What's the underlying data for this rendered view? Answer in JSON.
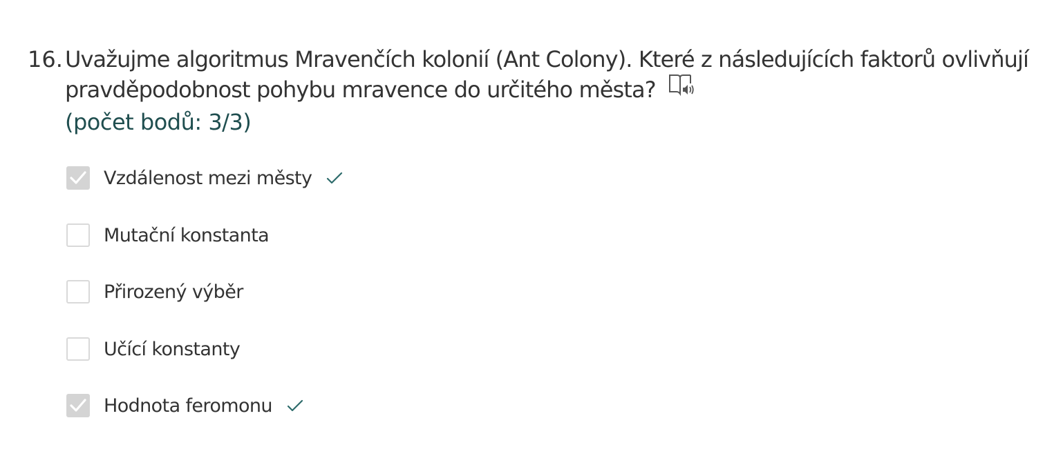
{
  "question": {
    "number": "16.",
    "text": "Uvažujme algoritmus Mravenčích kolonií (Ant Colony). Které z následujících faktorů ovlivňují pravděpodobnost pohybu mravence do určitého města?",
    "score": "(počet bodů: 3/3)",
    "reader_icon": "read-aloud-book-icon"
  },
  "options": [
    {
      "label": "Vzdálenost mezi městy",
      "checked": true,
      "correct_mark": true
    },
    {
      "label": "Mutační konstanta",
      "checked": false,
      "correct_mark": false
    },
    {
      "label": "Přirozený výběr",
      "checked": false,
      "correct_mark": false
    },
    {
      "label": "Učící konstanty",
      "checked": false,
      "correct_mark": false
    },
    {
      "label": "Hodnota feromonu",
      "checked": true,
      "correct_mark": true
    }
  ],
  "colors": {
    "text": "#333333",
    "score": "#1f4e4f",
    "check_mark": "#2d6b6b",
    "checkbox_border": "#d9d9d9",
    "checkbox_checked_fill": "#d4d4d4"
  }
}
